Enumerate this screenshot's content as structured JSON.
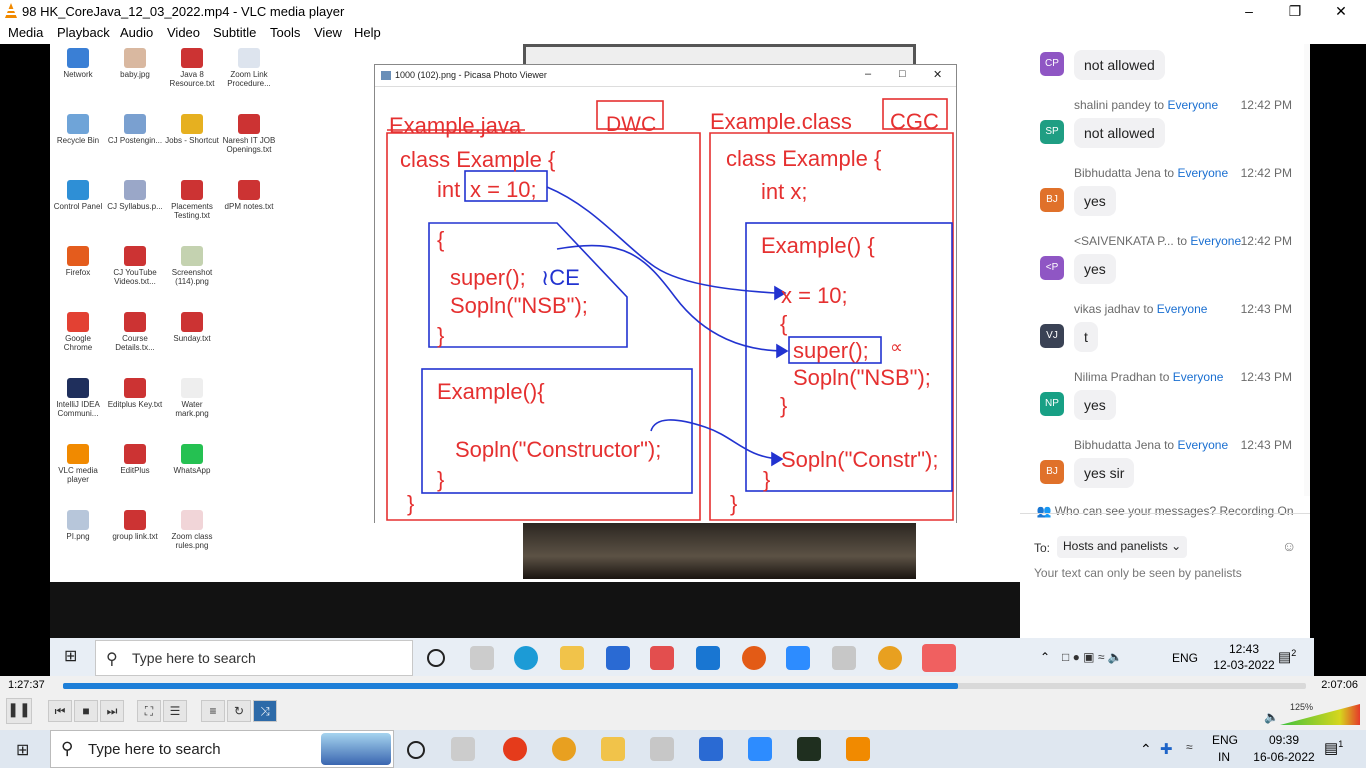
{
  "window": {
    "title": "98 HK_CoreJava_12_03_2022.mp4 - VLC media player"
  },
  "menu": [
    "Media",
    "Playback",
    "Audio",
    "Video",
    "Subtitle",
    "Tools",
    "View",
    "Help"
  ],
  "desktop_icons": [
    {
      "label": "Network",
      "color": "#3a7fd5"
    },
    {
      "label": "baby.jpg",
      "color": "#d9b8a0"
    },
    {
      "label": "Java 8 Resource.txt",
      "color": "#cc3333"
    },
    {
      "label": "Zoom Link Procedure...",
      "color": "#dde4ee"
    },
    {
      "label": "Recycle Bin",
      "color": "#6fa4d8"
    },
    {
      "label": "CJ Postengin...",
      "color": "#7aa0d0"
    },
    {
      "label": "Jobs - Shortcut",
      "color": "#e6b020"
    },
    {
      "label": "Naresh IT JOB Openings.txt",
      "color": "#cc3333"
    },
    {
      "label": "Control Panel",
      "color": "#2e8fd6"
    },
    {
      "label": "CJ Syllabus.p...",
      "color": "#9aa7c8"
    },
    {
      "label": "Placements Testing.txt",
      "color": "#cc3333"
    },
    {
      "label": "dPM notes.txt",
      "color": "#cc3333"
    },
    {
      "label": "Firefox",
      "color": "#e45c1d"
    },
    {
      "label": "CJ YouTube Videos.txt...",
      "color": "#cc3333"
    },
    {
      "label": "Screenshot (114).png",
      "color": "#c4d2b0"
    },
    {
      "label": "Google Chrome",
      "color": "#e34133"
    },
    {
      "label": "Course Details.tx...",
      "color": "#cc3333"
    },
    {
      "label": "Sunday.txt",
      "color": "#cc3333"
    },
    {
      "label": "IntelliJ IDEA Communi...",
      "color": "#1f2f5c"
    },
    {
      "label": "Editplus Key.txt",
      "color": "#cc3333"
    },
    {
      "label": "Water mark.png",
      "color": "#eeeeee"
    },
    {
      "label": "VLC media player",
      "color": "#f18a00"
    },
    {
      "label": "EditPlus",
      "color": "#cc3333"
    },
    {
      "label": "WhatsApp",
      "color": "#25c152"
    },
    {
      "label": "PI.png",
      "color": "#b7c6da"
    },
    {
      "label": "group link.txt",
      "color": "#cc3333"
    },
    {
      "label": "Zoom class rules.png",
      "color": "#f1d5d8"
    }
  ],
  "picasa": {
    "title": "1000 (102).png - Picasa Photo Viewer"
  },
  "board": {
    "left_title": "Example.java",
    "left_tag": "DWC",
    "right_title": "Example.class",
    "right_tag": "CGC",
    "l1": "class Example {",
    "l2a": "int",
    "l2b": "x = 10;",
    "l3": "{",
    "l4": "super(); ",
    "l4b": "≀CE",
    "l5": "Sopln(\"NSB\");",
    "l6": "}",
    "l7": "Example(){",
    "l8": "Sopln(\"Constructor\");",
    "l9": "}",
    "l10": "}",
    "r1": "class Example {",
    "r2": "int x;",
    "r3": "Example() {",
    "r4": "x = 10;",
    "r5": "{",
    "r6": "super();",
    "r6b": "∝",
    "r7": "Sopln(\"NSB\");",
    "r8": "}",
    "r9": "Sopln(\"Constr\");",
    "r10": "}",
    "r11": "}"
  },
  "chat": {
    "first_bubble": "not allowed",
    "first_initials": "CP",
    "first_color": "#8f56c4",
    "messages": [
      {
        "name": "shalini pandey",
        "to": "to",
        "target": "Everyone",
        "time": "12:42 PM",
        "initials": "SP",
        "color": "#1f9e83",
        "text": "not allowed"
      },
      {
        "name": "Bibhudatta Jena",
        "to": "to",
        "target": "Everyone",
        "time": "12:42 PM",
        "initials": "BJ",
        "color": "#e0712a",
        "text": "yes"
      },
      {
        "name": "<SAIVENKATA P...",
        "to": "to",
        "target": "Everyone",
        "time": "12:42 PM",
        "initials": "<P",
        "color": "#8f56c4",
        "text": "yes"
      },
      {
        "name": "vikas jadhav",
        "to": "to",
        "target": "Everyone",
        "time": "12:43 PM",
        "initials": "VJ",
        "color": "#3a4255",
        "text": "t"
      },
      {
        "name": "Nilima Pradhan",
        "to": "to",
        "target": "Everyone",
        "time": "12:43 PM",
        "initials": "NP",
        "color": "#18a085",
        "text": "yes"
      },
      {
        "name": "Bibhudatta Jena",
        "to": "to",
        "target": "Everyone",
        "time": "12:43 PM",
        "initials": "BJ",
        "color": "#e0712a",
        "text": "yes sir"
      }
    ],
    "who_can_see": "Who can see your messages? Recording On",
    "to_label": "To:",
    "to_value": "Hosts and panelists",
    "placeholder": "Your text can only be seen by panelists"
  },
  "inner_taskbar": {
    "search": "Type here to search",
    "lang": "ENG",
    "time": "12:43",
    "date": "12-03-2022",
    "notif": "2"
  },
  "player": {
    "elapsed": "1:27:37",
    "total": "2:07:06",
    "progress": 0.72,
    "volume": "125%"
  },
  "outer_taskbar": {
    "search": "Type here to search",
    "lang": "ENG",
    "region": "IN",
    "time": "09:39",
    "date": "16-06-2022",
    "notif": "1"
  }
}
